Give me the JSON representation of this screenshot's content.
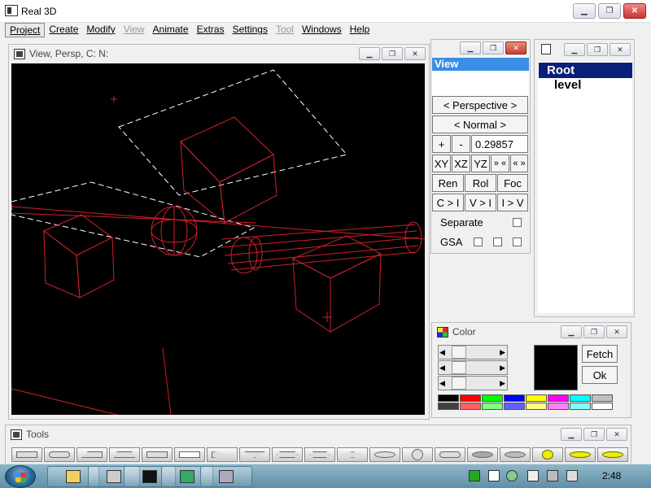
{
  "app": {
    "title": "Real 3D"
  },
  "menu": [
    {
      "label": "Project",
      "state": "active"
    },
    {
      "label": "Create",
      "state": "normal"
    },
    {
      "label": "Modify",
      "state": "normal"
    },
    {
      "label": "View",
      "state": "disabled"
    },
    {
      "label": "Animate",
      "state": "normal"
    },
    {
      "label": "Extras",
      "state": "normal"
    },
    {
      "label": "Settings",
      "state": "normal"
    },
    {
      "label": "Tool",
      "state": "disabled"
    },
    {
      "label": "Windows",
      "state": "normal"
    },
    {
      "label": "Help",
      "state": "normal"
    }
  ],
  "view_window": {
    "title": "View, Persp, C: N:"
  },
  "view_panel": {
    "header": "View",
    "projection": "< Perspective >",
    "mode": "< Normal >",
    "plus": "+",
    "minus": "-",
    "zoom_value": "0.29857",
    "xy": "XY",
    "xz": "XZ",
    "yz": "YZ",
    "fwd": "» «",
    "back": "« »",
    "ren": "Ren",
    "rol": "Rol",
    "foc": "Foc",
    "c_i": "C > I",
    "v_i": "V > I",
    "i_v": "I > V",
    "separate": "Separate",
    "gsa": "GSA"
  },
  "tree_window": {
    "root": "Root",
    "child": "level"
  },
  "color_window": {
    "title": "Color",
    "fetch": "Fetch",
    "ok": "Ok",
    "current_color": "#000000",
    "palette_top": [
      "#000000",
      "#ff0000",
      "#00ff00",
      "#0000ff",
      "#ffff00",
      "#ff00ff",
      "#00ffff",
      "#c0c0c0"
    ],
    "palette_bottom": [
      "#404040",
      "#ff6060",
      "#80ff80",
      "#6060ff",
      "#ffff80",
      "#ff80ff",
      "#80ffff",
      "#ffffff"
    ]
  },
  "tools_window": {
    "title": "Tools"
  },
  "taskbar": {
    "clock": "2:48"
  }
}
